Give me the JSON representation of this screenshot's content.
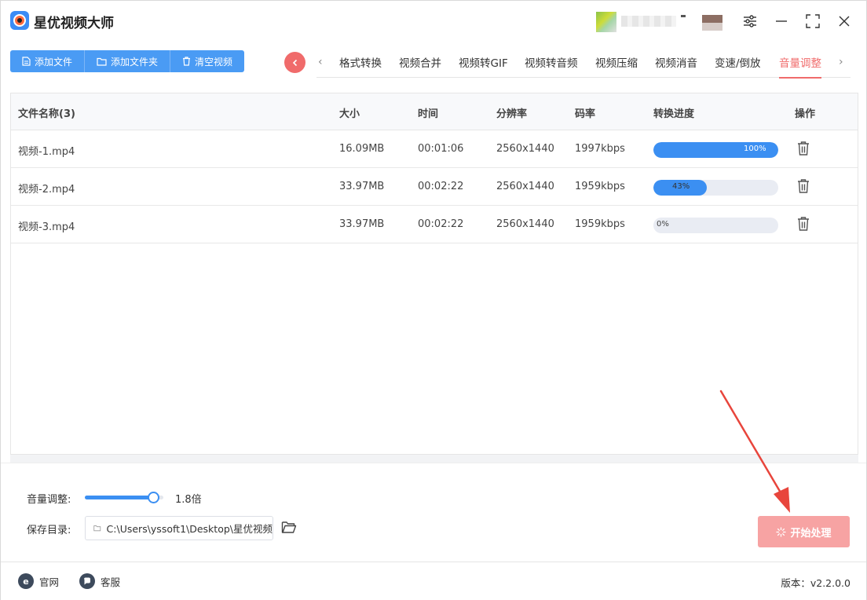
{
  "app": {
    "title": "星优视频大师"
  },
  "toolbar": {
    "add_file": "添加文件",
    "add_folder": "添加文件夹",
    "clear_videos": "清空视频"
  },
  "tabs": [
    {
      "label": "格式转换",
      "active": false
    },
    {
      "label": "视频合并",
      "active": false
    },
    {
      "label": "视频转GIF",
      "active": false
    },
    {
      "label": "视频转音频",
      "active": false
    },
    {
      "label": "视频压缩",
      "active": false
    },
    {
      "label": "视频消音",
      "active": false
    },
    {
      "label": "变速/倒放",
      "active": false
    },
    {
      "label": "音量调整",
      "active": true
    }
  ],
  "table": {
    "headers": {
      "name": "文件名称(3)",
      "size": "大小",
      "duration": "时间",
      "resolution": "分辨率",
      "bitrate": "码率",
      "progress": "转换进度",
      "actions": "操作"
    },
    "rows": [
      {
        "name": "视频-1.mp4",
        "size": "16.09MB",
        "duration": "00:01:06",
        "resolution": "2560x1440",
        "bitrate": "1997kbps",
        "progress": 100,
        "progress_text": "100%"
      },
      {
        "name": "视频-2.mp4",
        "size": "33.97MB",
        "duration": "00:02:22",
        "resolution": "2560x1440",
        "bitrate": "1959kbps",
        "progress": 43,
        "progress_text": "43%"
      },
      {
        "name": "视频-3.mp4",
        "size": "33.97MB",
        "duration": "00:02:22",
        "resolution": "2560x1440",
        "bitrate": "1959kbps",
        "progress": 0,
        "progress_text": "0%"
      }
    ]
  },
  "settings": {
    "volume_label": "音量调整:",
    "volume_value": "1.8倍",
    "volume_fraction": 0.87,
    "save_dir_label": "保存目录:",
    "save_dir_value": "C:\\Users\\yssoft1\\Desktop\\星优视频"
  },
  "start_button": {
    "label": "开始处理"
  },
  "statusbar": {
    "website": "官网",
    "support": "客服",
    "version": "版本：v2.2.0.0"
  },
  "colors": {
    "accent_blue": "#4a9bf4",
    "progress_blue": "#3b8ff2",
    "accent_red": "#f06b6b",
    "start_button": "#f7a3a3",
    "annotation_arrow": "#e8453c"
  }
}
